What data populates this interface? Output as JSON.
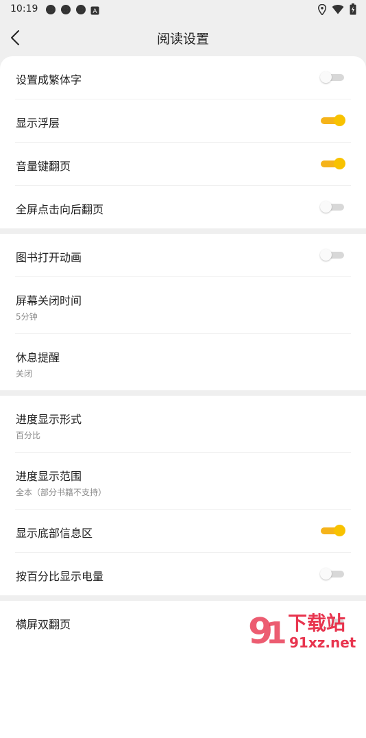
{
  "status": {
    "time": "10:19",
    "left_icons": [
      "app-icon",
      "app-icon",
      "app-icon",
      "a-icon"
    ],
    "right_icons": [
      "location-icon",
      "wifi-icon",
      "battery-icon"
    ]
  },
  "header": {
    "title": "阅读设置"
  },
  "sections": [
    {
      "rows": [
        {
          "label": "设置成繁体字",
          "toggle": "off"
        },
        {
          "label": "显示浮层",
          "toggle": "on"
        },
        {
          "label": "音量键翻页",
          "toggle": "on"
        },
        {
          "label": "全屏点击向后翻页",
          "toggle": "off"
        }
      ]
    },
    {
      "rows": [
        {
          "label": "图书打开动画",
          "toggle": "off"
        },
        {
          "label": "屏幕关闭时间",
          "value": "5分钟"
        },
        {
          "label": "休息提醒",
          "value": "关闭"
        }
      ]
    },
    {
      "rows": [
        {
          "label": "进度显示形式",
          "value": "百分比"
        },
        {
          "label": "进度显示范围",
          "value": "全本（部分书籍不支持）"
        },
        {
          "label": "显示底部信息区",
          "toggle": "on"
        },
        {
          "label": "按百分比显示电量",
          "toggle": "off"
        }
      ]
    },
    {
      "rows": [
        {
          "label": "横屏双翻页",
          "toggle": "off"
        }
      ]
    }
  ],
  "watermark": {
    "big": "下载站",
    "small": "91xz.net"
  },
  "colors": {
    "accent": "#f8c200",
    "background": "#efefef"
  }
}
